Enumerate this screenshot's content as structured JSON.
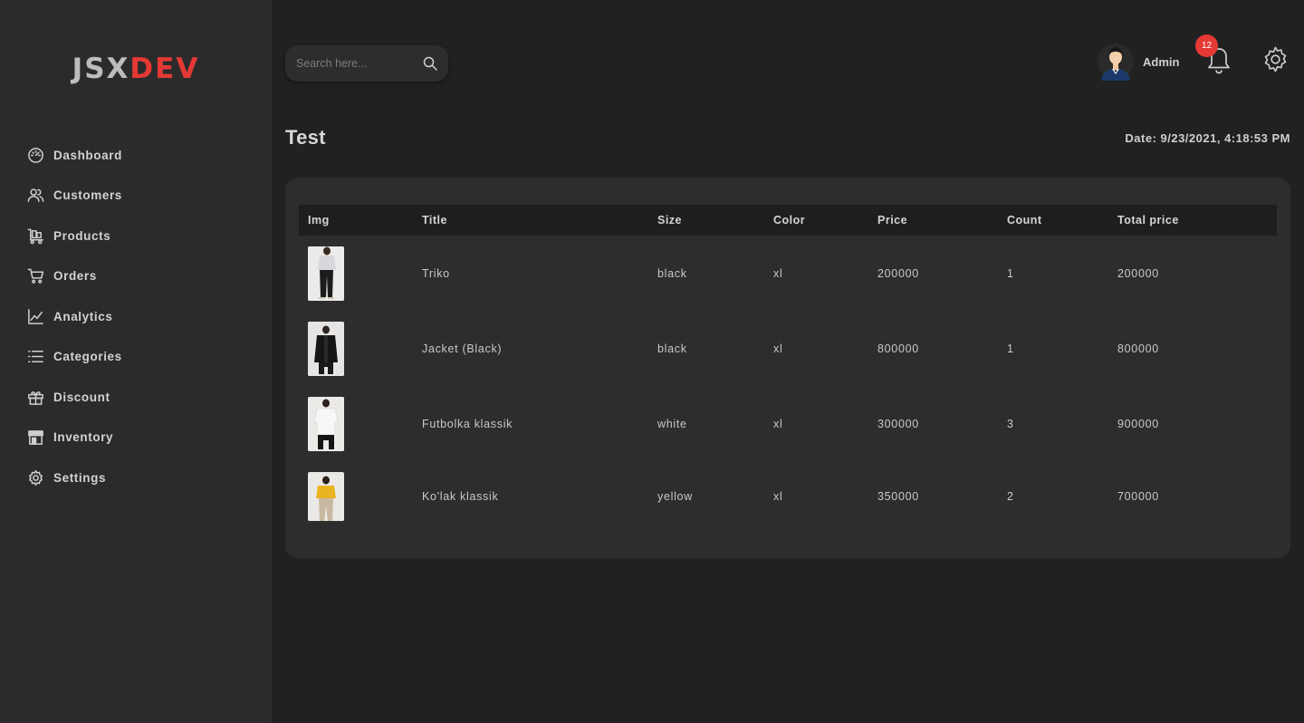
{
  "brand": {
    "part1": "JSX",
    "part2": "DEV",
    "color_accent": "#e53935"
  },
  "sidebar": {
    "items": [
      {
        "label": "Dashboard",
        "icon": "dashboard-icon"
      },
      {
        "label": "Customers",
        "icon": "users-icon"
      },
      {
        "label": "Products",
        "icon": "cart-flatbed-icon"
      },
      {
        "label": "Orders",
        "icon": "shopping-cart-icon"
      },
      {
        "label": "Analytics",
        "icon": "chart-line-icon"
      },
      {
        "label": "Categories",
        "icon": "list-icon"
      },
      {
        "label": "Discount",
        "icon": "gift-icon"
      },
      {
        "label": "Inventory",
        "icon": "store-icon"
      },
      {
        "label": "Settings",
        "icon": "gear-icon"
      }
    ]
  },
  "header": {
    "search_placeholder": "Search here...",
    "user_name": "Admin",
    "notification_count": "12"
  },
  "page": {
    "title": "Test",
    "date": "Date: 9/23/2021, 4:18:53 PM"
  },
  "table": {
    "columns": [
      "Img",
      "Title",
      "Size",
      "Color",
      "Price",
      "Count",
      "Total price"
    ],
    "rows": [
      {
        "title": "Triko",
        "size": "black",
        "color": "xl",
        "price": "200000",
        "count": "1",
        "total": "200000"
      },
      {
        "title": "Jacket (Black)",
        "size": "black",
        "color": "xl",
        "price": "800000",
        "count": "1",
        "total": "800000"
      },
      {
        "title": "Futbolka klassik",
        "size": "white",
        "color": "xl",
        "price": "300000",
        "count": "3",
        "total": "900000"
      },
      {
        "title": "Ko'lak klassik",
        "size": "yellow",
        "color": "xl",
        "price": "350000",
        "count": "2",
        "total": "700000"
      }
    ]
  }
}
